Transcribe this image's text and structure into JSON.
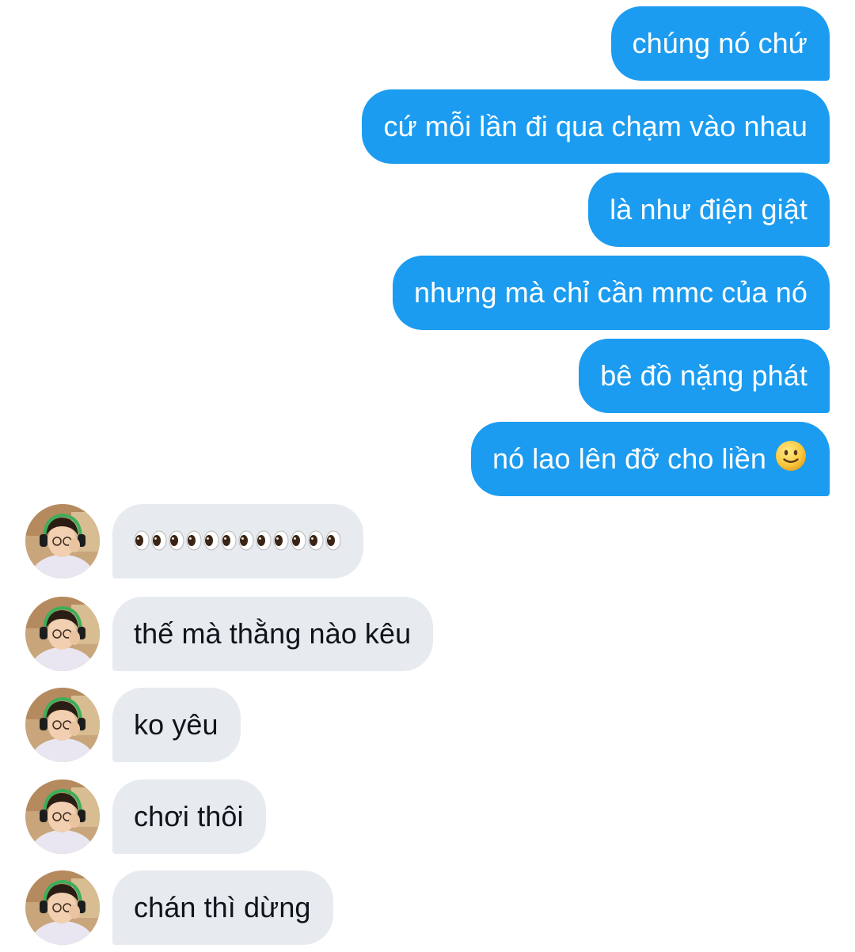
{
  "conversation": {
    "outgoing": [
      {
        "text": "chúng nó chứ"
      },
      {
        "text": "cứ mỗi lần đi qua chạm vào nhau"
      },
      {
        "text": "là như điện giật"
      },
      {
        "text": "nhưng mà chỉ cần mmc của nó"
      },
      {
        "text": "bê đồ nặng phát"
      },
      {
        "text": "nó lao lên đỡ cho liền",
        "emoji": "slightly-smiling-face"
      }
    ],
    "incoming": [
      {
        "text": "",
        "emoji": "eyes",
        "emoji_count": 12
      },
      {
        "text": "thế mà thằng nào kêu"
      },
      {
        "text": "ko yêu"
      },
      {
        "text": "chơi thôi"
      },
      {
        "text": "chán thì dừng"
      }
    ]
  },
  "colors": {
    "outgoing_bubble": "#1c9cf0",
    "incoming_bubble": "#e7ebf0",
    "outgoing_text": "#ffffff",
    "incoming_text": "#0f1419"
  }
}
